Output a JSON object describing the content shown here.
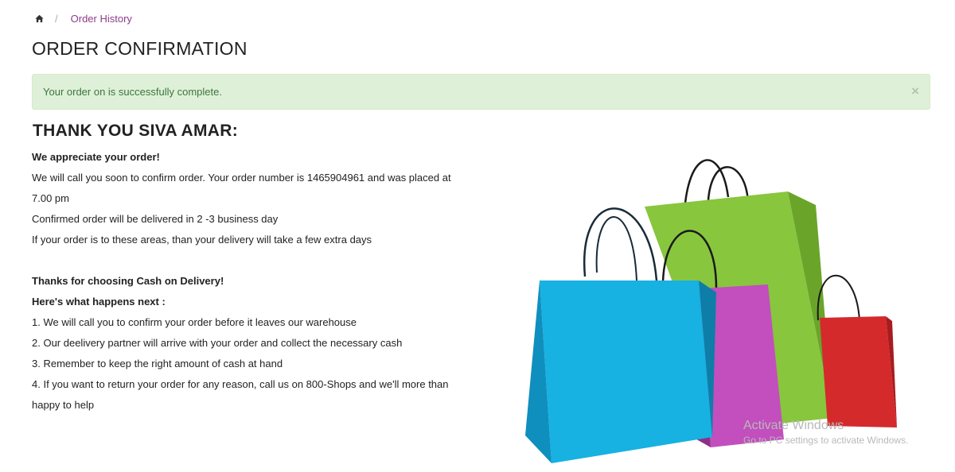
{
  "breadcrumb": {
    "home_icon": "home-icon",
    "separator": "/",
    "current": "Order History"
  },
  "page": {
    "title": "ORDER CONFIRMATION"
  },
  "alert": {
    "message": "Your order on is successfully complete.",
    "close": "×",
    "color": "#dff0d8"
  },
  "confirmation": {
    "heading": "THANK YOU SIVA AMAR:",
    "appreciate": "We appreciate your order!",
    "call_line1": "We will call you soon to confirm order. Your order number is 1465904961 and was placed at",
    "call_line2": "7.00 pm",
    "delivery": "Confirmed order will be delivered in 2 -3 business day",
    "areas": "If your order is to these areas, than your delivery will take a few extra days",
    "cod_title": "Thanks for choosing Cash on Delivery!",
    "next_title": "Here's what happens next :",
    "step1": "1. We will call you to confirm your order before it leaves our warehouse",
    "step2": "2. Our deelivery partner will arrive with your order and collect the necessary cash",
    "step3": "3. Remember to keep the right amount of cash at hand",
    "step4_line1": "4. If you want to return your order for any reason, call us on 800-Shops and we'll more than",
    "step4_line2": "happy to help"
  },
  "watermark": {
    "title": "Activate Windows",
    "subtitle": "Go to PC settings to activate Windows."
  },
  "colors": {
    "link": "#8c3d8c",
    "bag_blue": "#1ab0e0",
    "bag_green": "#7cc43a",
    "bag_purple": "#c048b8",
    "bag_red": "#d8262a"
  }
}
